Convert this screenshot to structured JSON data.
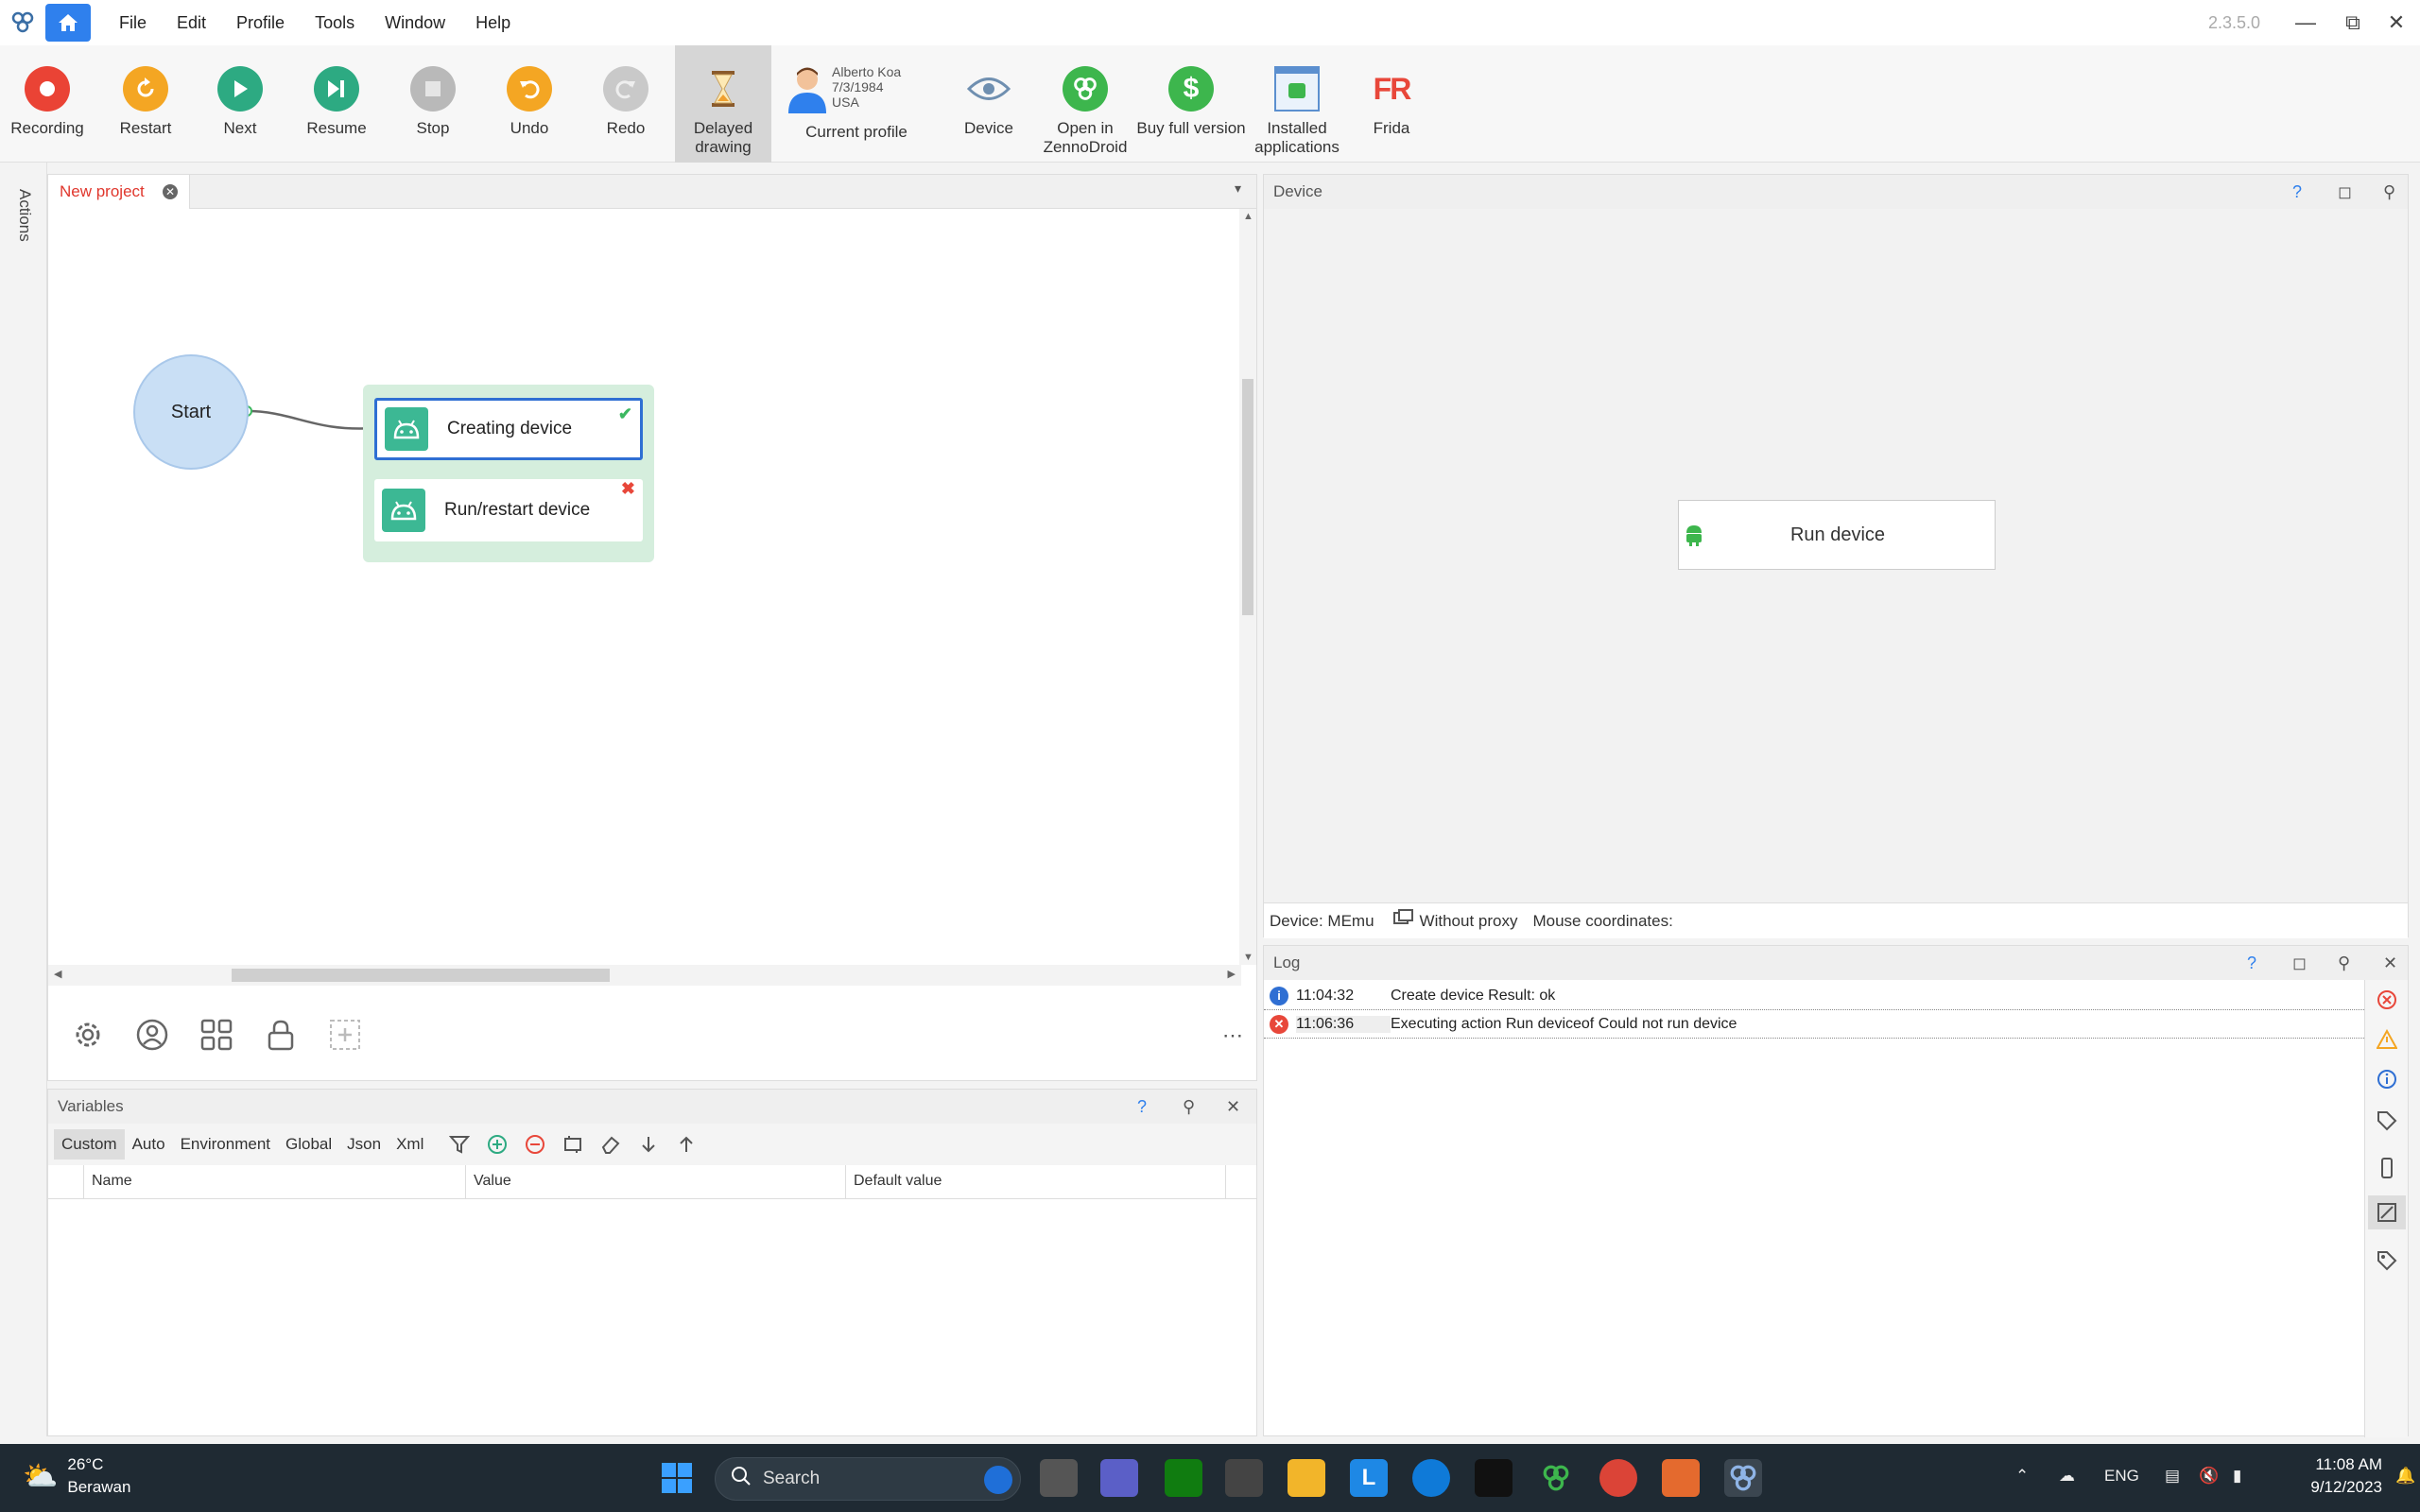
{
  "app": {
    "version": "2.3.5.0"
  },
  "menu": [
    "File",
    "Edit",
    "Profile",
    "Tools",
    "Window",
    "Help"
  ],
  "toolbar": {
    "recording": "Recording",
    "restart": "Restart",
    "next": "Next",
    "resume": "Resume",
    "stop": "Stop",
    "undo": "Undo",
    "redo": "Redo",
    "delayed_drawing_1": "Delayed",
    "delayed_drawing_2": "drawing",
    "profile_name": "Alberto Koa",
    "profile_dob": "7/3/1984",
    "profile_country": "USA",
    "current_profile": "Current profile",
    "device": "Device",
    "open_zenno_1": "Open in",
    "open_zenno_2": "ZennoDroid",
    "buy_full": "Buy full version",
    "installed_1": "Installed",
    "installed_2": "applications",
    "frida": "Frida"
  },
  "sidebar": {
    "actions": "Actions"
  },
  "editor": {
    "tab_name": "New project",
    "start_label": "Start",
    "nodes": [
      {
        "name": "Creating device",
        "status": "success"
      },
      {
        "name": "Run/restart device",
        "status": "error"
      }
    ]
  },
  "variables": {
    "title": "Variables",
    "tabs": [
      "Custom",
      "Auto",
      "Environment",
      "Global",
      "Json",
      "Xml"
    ],
    "selected_tab": "Custom",
    "columns": [
      "Name",
      "Value",
      "Default value"
    ]
  },
  "device": {
    "title": "Device",
    "run_button": "Run device",
    "status_device": "Device: MEmu",
    "status_proxy": "Without proxy",
    "status_mouse": "Mouse coordinates:"
  },
  "log": {
    "title": "Log",
    "entries": [
      {
        "type": "info",
        "time": "11:04:32",
        "message": "Create device  Result: ok"
      },
      {
        "type": "error",
        "time": "11:06:36",
        "message": "Executing action Run deviceof  Could not run device"
      }
    ]
  },
  "taskbar": {
    "temperature": "26°C",
    "weather": "Berawan",
    "search": "Search",
    "language": "ENG",
    "time": "11:08 AM",
    "date": "9/12/2023"
  }
}
